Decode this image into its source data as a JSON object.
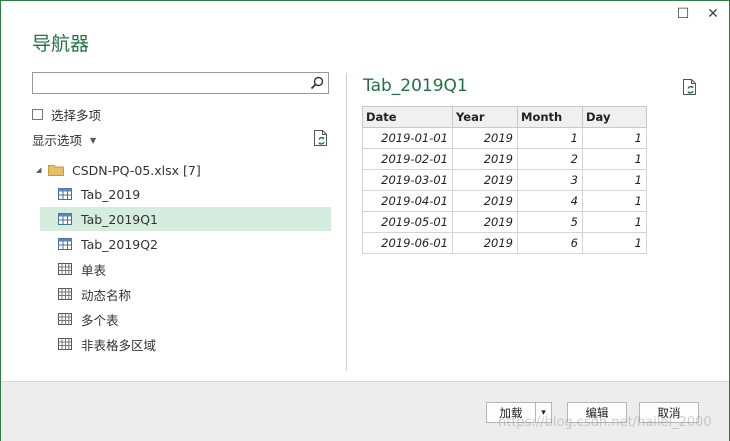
{
  "window": {
    "minimize_glyph": "☐",
    "close_glyph": "✕"
  },
  "title": "导航器",
  "search": {
    "value": "",
    "placeholder": ""
  },
  "select_multiple_label": "选择多项",
  "display_options_label": "显示选项",
  "tree": {
    "root_label": "CSDN-PQ-05.xlsx [7]",
    "items": [
      {
        "label": "Tab_2019",
        "icon": "table-icon",
        "selected": false
      },
      {
        "label": "Tab_2019Q1",
        "icon": "table-icon",
        "selected": true
      },
      {
        "label": "Tab_2019Q2",
        "icon": "table-icon",
        "selected": false
      },
      {
        "label": "单表",
        "icon": "sheet-icon",
        "selected": false
      },
      {
        "label": "动态名称",
        "icon": "sheet-icon",
        "selected": false
      },
      {
        "label": "多个表",
        "icon": "sheet-icon",
        "selected": false
      },
      {
        "label": "非表格多区域",
        "icon": "sheet-icon",
        "selected": false
      }
    ]
  },
  "preview": {
    "title": "Tab_2019Q1",
    "columns": [
      "Date",
      "Year",
      "Month",
      "Day"
    ],
    "rows": [
      [
        "2019-01-01",
        "2019",
        "1",
        "1"
      ],
      [
        "2019-02-01",
        "2019",
        "2",
        "1"
      ],
      [
        "2019-03-01",
        "2019",
        "3",
        "1"
      ],
      [
        "2019-04-01",
        "2019",
        "4",
        "1"
      ],
      [
        "2019-05-01",
        "2019",
        "5",
        "1"
      ],
      [
        "2019-06-01",
        "2019",
        "6",
        "1"
      ]
    ]
  },
  "buttons": {
    "load": "加载",
    "load_dropdown": "▾",
    "edit": "编辑",
    "cancel": "取消"
  },
  "watermark": "https://blog.csdn.net/hailei_2000",
  "colors": {
    "accent": "#217346",
    "selected_bg": "#d4edde",
    "border": "#2f7d45"
  }
}
